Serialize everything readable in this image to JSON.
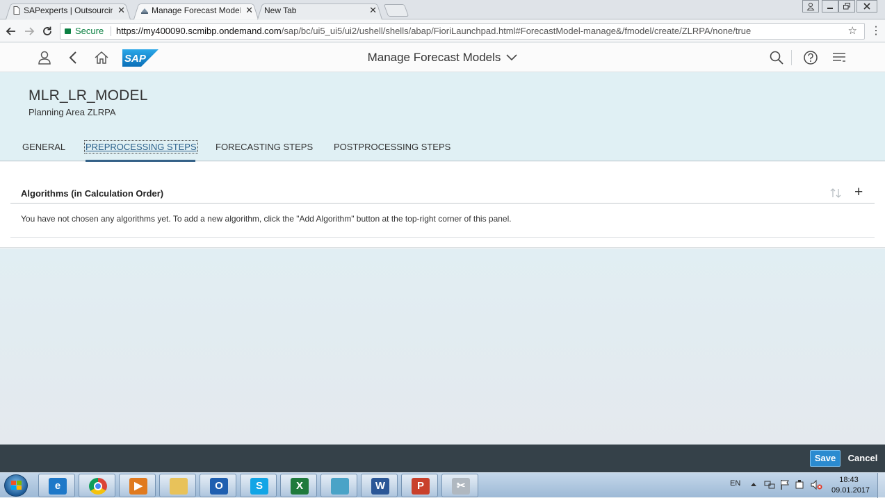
{
  "browser": {
    "tabs": [
      {
        "label": "SAPexperts | Outsourcing",
        "close": "✕"
      },
      {
        "label": "Manage Forecast Models",
        "close": "✕"
      },
      {
        "label": "New Tab",
        "close": "✕"
      }
    ],
    "secure_label": "Secure",
    "url_host": "https://my400090.scmibp.ondemand.com",
    "url_path": "/sap/bc/ui5_ui5/ui2/ushell/shells/abap/FioriLaunchpad.html#ForecastModel-manage&/fmodel/create/ZLRPA/none/true"
  },
  "shell": {
    "title": "Manage Forecast Models",
    "logo_text": "SAP"
  },
  "object": {
    "title": "MLR_LR_MODEL",
    "subtitle": "Planning Area ZLRPA",
    "tabs": [
      "GENERAL",
      "PREPROCESSING STEPS",
      "FORECASTING STEPS",
      "POSTPROCESSING STEPS"
    ]
  },
  "panel": {
    "title": "Algorithms (in Calculation Order)",
    "add_symbol": "+",
    "message": "You have not chosen any algorithms yet. To add a new algorithm, click the \"Add Algorithm\" button at the top-right corner of this panel."
  },
  "footer": {
    "save_label": "Save",
    "cancel_label": "Cancel"
  },
  "taskbar": {
    "language": "EN",
    "time": "18:43",
    "date": "09.01.2017",
    "apps": [
      {
        "name": "internet-explorer",
        "glyph": "e",
        "color": "#1e78c8"
      },
      {
        "name": "chrome",
        "glyph": "",
        "color": "#dd4b39"
      },
      {
        "name": "media-player",
        "glyph": "▶",
        "color": "#e07a1f"
      },
      {
        "name": "file-explorer",
        "glyph": "",
        "color": "#e8c25a"
      },
      {
        "name": "outlook",
        "glyph": "O",
        "color": "#1f5fb0"
      },
      {
        "name": "skype",
        "glyph": "S",
        "color": "#12a5e6"
      },
      {
        "name": "excel",
        "glyph": "X",
        "color": "#1f7a3c"
      },
      {
        "name": "notes",
        "glyph": "",
        "color": "#4aa3c7"
      },
      {
        "name": "word",
        "glyph": "W",
        "color": "#2b5797"
      },
      {
        "name": "powerpoint",
        "glyph": "P",
        "color": "#c9402b"
      },
      {
        "name": "snipping-tool",
        "glyph": "✂",
        "color": "#b0b8c0"
      }
    ]
  }
}
